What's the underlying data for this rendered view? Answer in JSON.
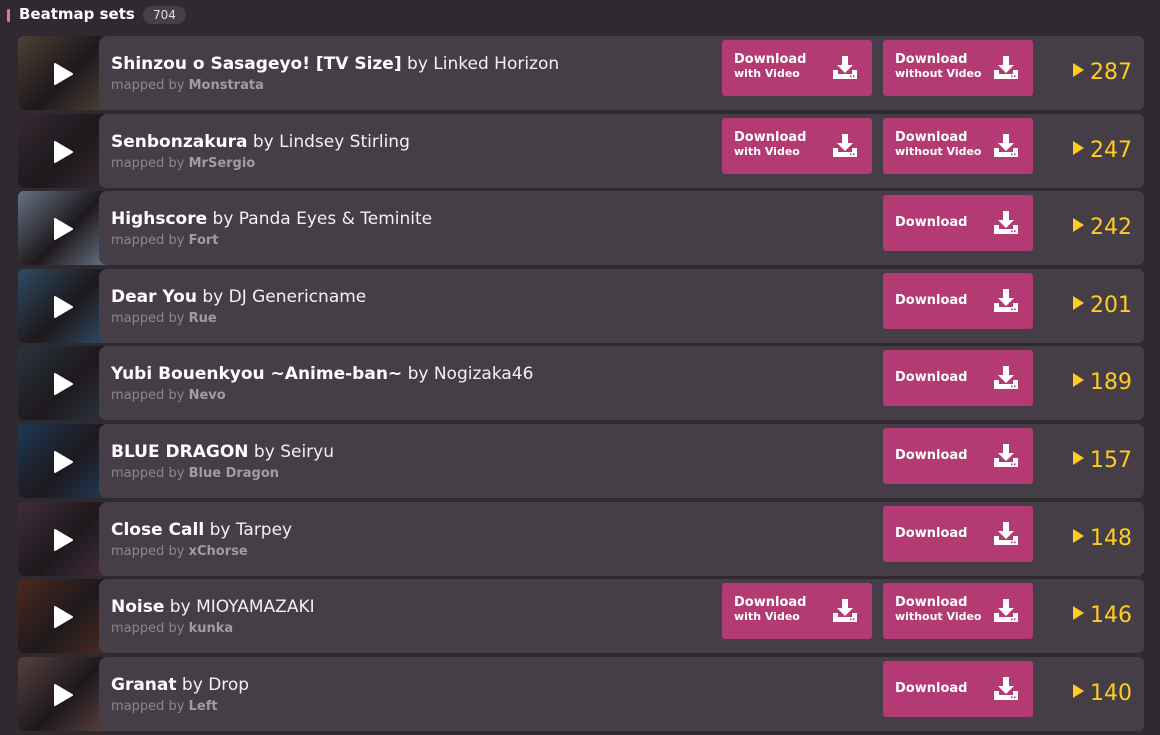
{
  "header": {
    "title": "Beatmap sets",
    "count": "704"
  },
  "beatmaps": [
    {
      "song": "Shinzou o Sasageyo! [TV Size]",
      "by_label": "by",
      "artist": "Linked Horizon",
      "mapped_by_label": "mapped by",
      "mapper": "Monstrata",
      "has_video": true,
      "plays": "287",
      "thumb_color": "#6b5a48"
    },
    {
      "song": "Senbonzakura",
      "by_label": "by",
      "artist": "Lindsey Stirling",
      "mapped_by_label": "mapped by",
      "mapper": "MrSergio",
      "has_video": true,
      "plays": "247",
      "thumb_color": "#4a3a44"
    },
    {
      "song": "Highscore",
      "by_label": "by",
      "artist": "Panda Eyes & Teminite",
      "mapped_by_label": "mapped by",
      "mapper": "Fort",
      "has_video": false,
      "plays": "242",
      "thumb_color": "#8fa0b8"
    },
    {
      "song": "Dear You",
      "by_label": "by",
      "artist": "DJ Genericname",
      "mapped_by_label": "mapped by",
      "mapper": "Rue",
      "has_video": false,
      "plays": "201",
      "thumb_color": "#3f6a8a"
    },
    {
      "song": "Yubi Bouenkyou ~Anime-ban~",
      "by_label": "by",
      "artist": "Nogizaka46",
      "mapped_by_label": "mapped by",
      "mapper": "Nevo",
      "has_video": false,
      "plays": "189",
      "thumb_color": "#3a4a58"
    },
    {
      "song": "BLUE DRAGON",
      "by_label": "by",
      "artist": "Seiryu",
      "mapped_by_label": "mapped by",
      "mapper": "Blue Dragon",
      "has_video": false,
      "plays": "157",
      "thumb_color": "#2a4f7a"
    },
    {
      "song": "Close Call",
      "by_label": "by",
      "artist": "Tarpey",
      "mapped_by_label": "mapped by",
      "mapper": "xChorse",
      "has_video": false,
      "plays": "148",
      "thumb_color": "#5a3f52"
    },
    {
      "song": "Noise",
      "by_label": "by",
      "artist": "MIOYAMAZAKI",
      "mapped_by_label": "mapped by",
      "mapper": "kunka",
      "has_video": true,
      "plays": "146",
      "thumb_color": "#6a3a2a"
    },
    {
      "song": "Granat",
      "by_label": "by",
      "artist": "Drop",
      "mapped_by_label": "mapped by",
      "mapper": "Left",
      "has_video": false,
      "plays": "140",
      "thumb_color": "#7a5a58"
    }
  ],
  "buttons": {
    "download": "Download",
    "with_video": "with Video",
    "without_video": "without Video"
  },
  "colors": {
    "accent": "#ff66aa",
    "button": "#b33a73",
    "plays": "#ffcc22",
    "row_bg": "#463e46",
    "page_bg": "#2f2a2f"
  },
  "icons": {
    "play": "play-icon",
    "download": "download-icon",
    "plays": "play-count-icon"
  }
}
